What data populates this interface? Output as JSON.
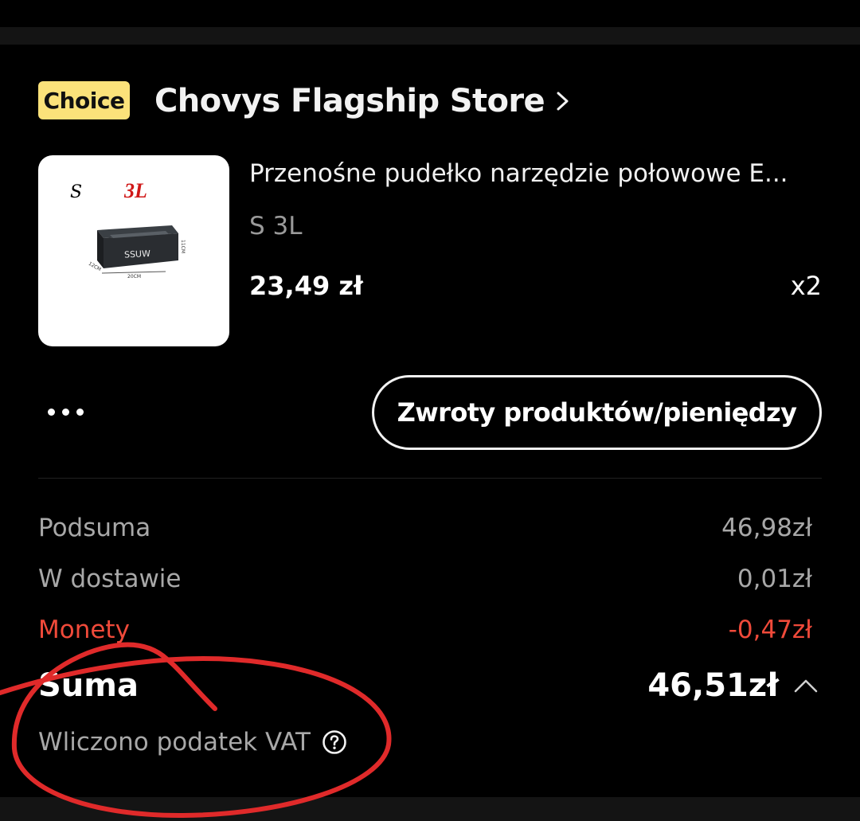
{
  "store": {
    "badge": "Choice",
    "name": "Chovys Flagship Store",
    "chevron_icon": "chevron-right-icon"
  },
  "product": {
    "image_labels": {
      "size": "S",
      "capacity": "3L",
      "brand": "SSUW",
      "dim_width": "20CM",
      "dim_depth": "12CM",
      "dim_height": "11CM"
    },
    "title": "Przenośne pudełko narzędzie połowowe E...",
    "variant": "S 3L",
    "unit_price": "23,49 zł",
    "quantity": "x2"
  },
  "actions": {
    "more_icon": "more-horizontal-icon",
    "refund_label": "Zwroty produktów/pieniędzy"
  },
  "summary": {
    "subtotal_label": "Podsuma",
    "subtotal_value": "46,98zł",
    "shipping_label": "W dostawie",
    "shipping_value": "0,01zł",
    "coins_label": "Monety",
    "coins_value": "-0,47zł",
    "total_label": "Suma",
    "total_value": "46,51zł",
    "expand_icon": "chevron-up-icon",
    "vat_note": "Wliczono podatek VAT",
    "help_icon": "question-circle-icon"
  },
  "colors": {
    "badge_bg": "#fbe27a",
    "discount_red": "#f04a3a",
    "annotation_red": "#e02a2a",
    "background": "#000000"
  }
}
